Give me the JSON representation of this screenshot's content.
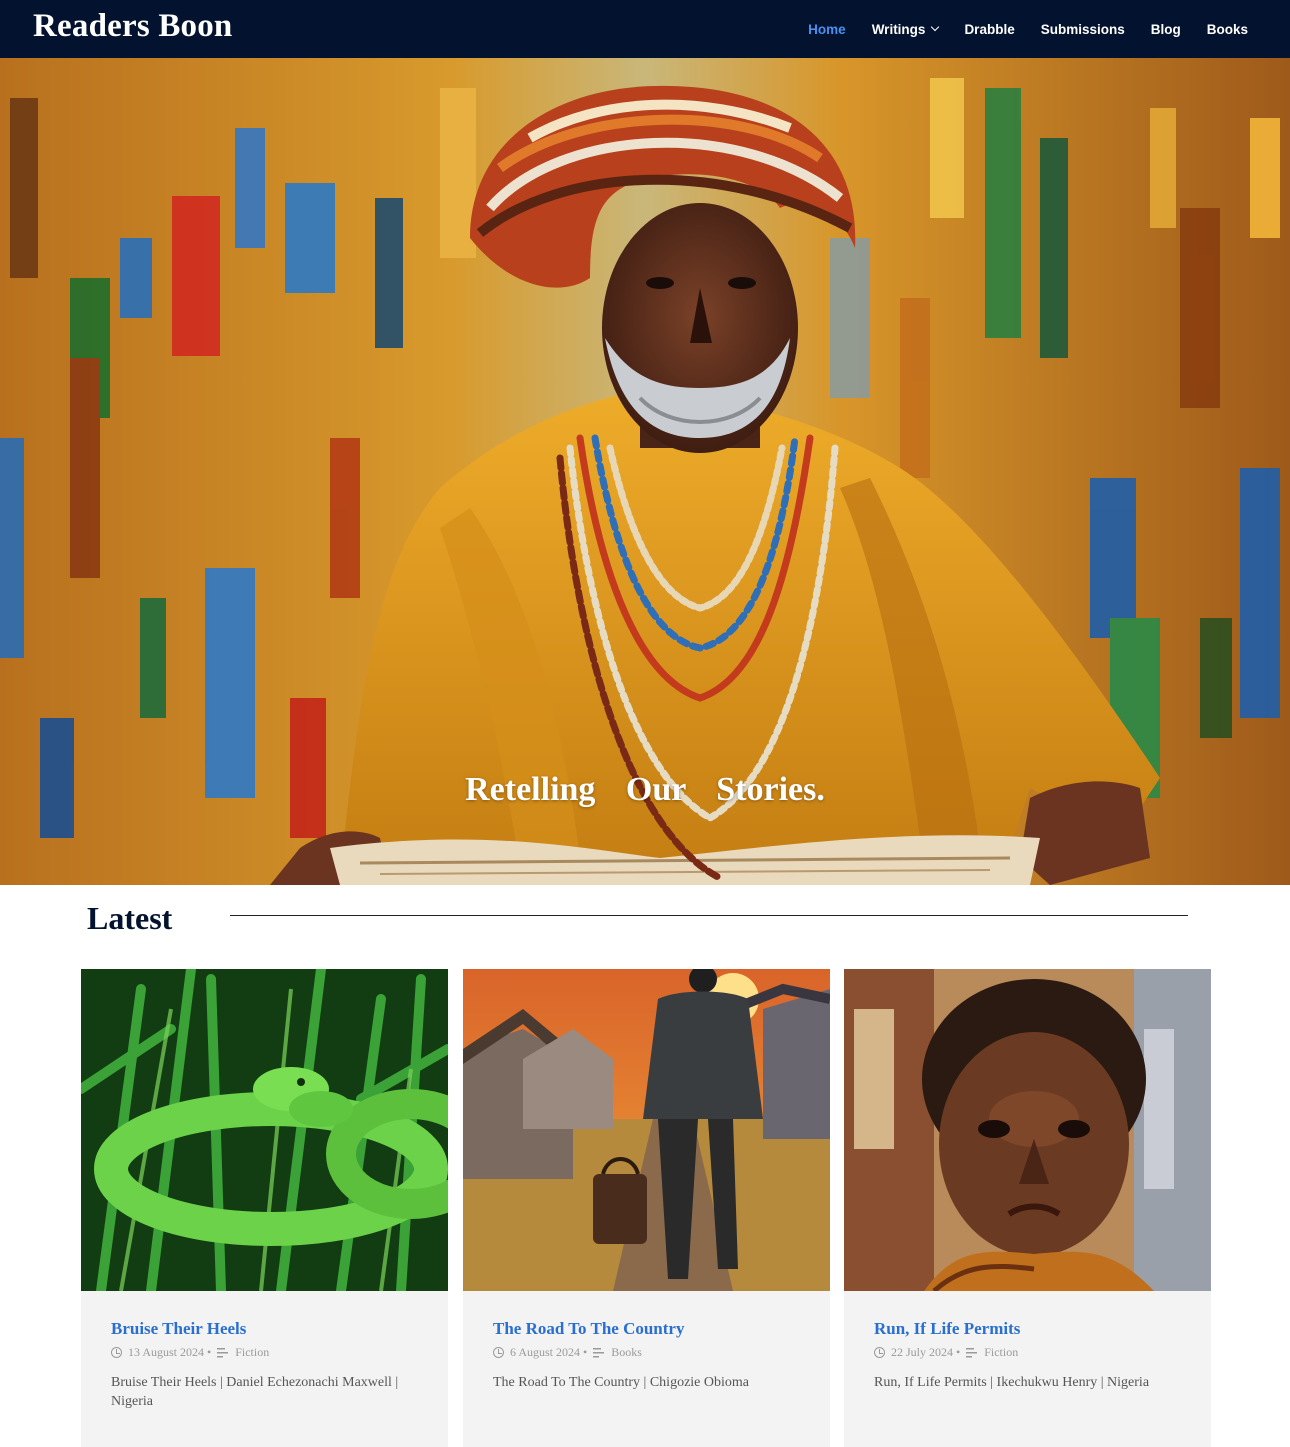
{
  "site": {
    "logo": "Readers Boon"
  },
  "nav": {
    "items": [
      {
        "label": "Home",
        "active": true
      },
      {
        "label": "Writings",
        "dropdown": true
      },
      {
        "label": "Drabble"
      },
      {
        "label": "Submissions"
      },
      {
        "label": "Blog"
      },
      {
        "label": "Books"
      }
    ]
  },
  "hero": {
    "tagline": "Retelling Our Stories."
  },
  "latest": {
    "heading": "Latest",
    "posts": [
      {
        "title": "Bruise Their Heels",
        "date": "13 August 2024",
        "category": "Fiction",
        "excerpt": "Bruise Their Heels | Daniel Echezonachi Maxwell | Nigeria"
      },
      {
        "title": "The Road To The Country",
        "date": "6 August 2024",
        "category": "Books",
        "excerpt": "The Road To The Country | Chigozie Obioma"
      },
      {
        "title": "Run, If Life Permits",
        "date": "22 July 2024",
        "category": "Fiction",
        "excerpt": "Run, If Life Permits | Ikechukwu Henry | Nigeria"
      }
    ]
  },
  "colors": {
    "nav_bg": "#03132f",
    "accent": "#2a6fd0",
    "nav_active": "#4a90f0"
  }
}
